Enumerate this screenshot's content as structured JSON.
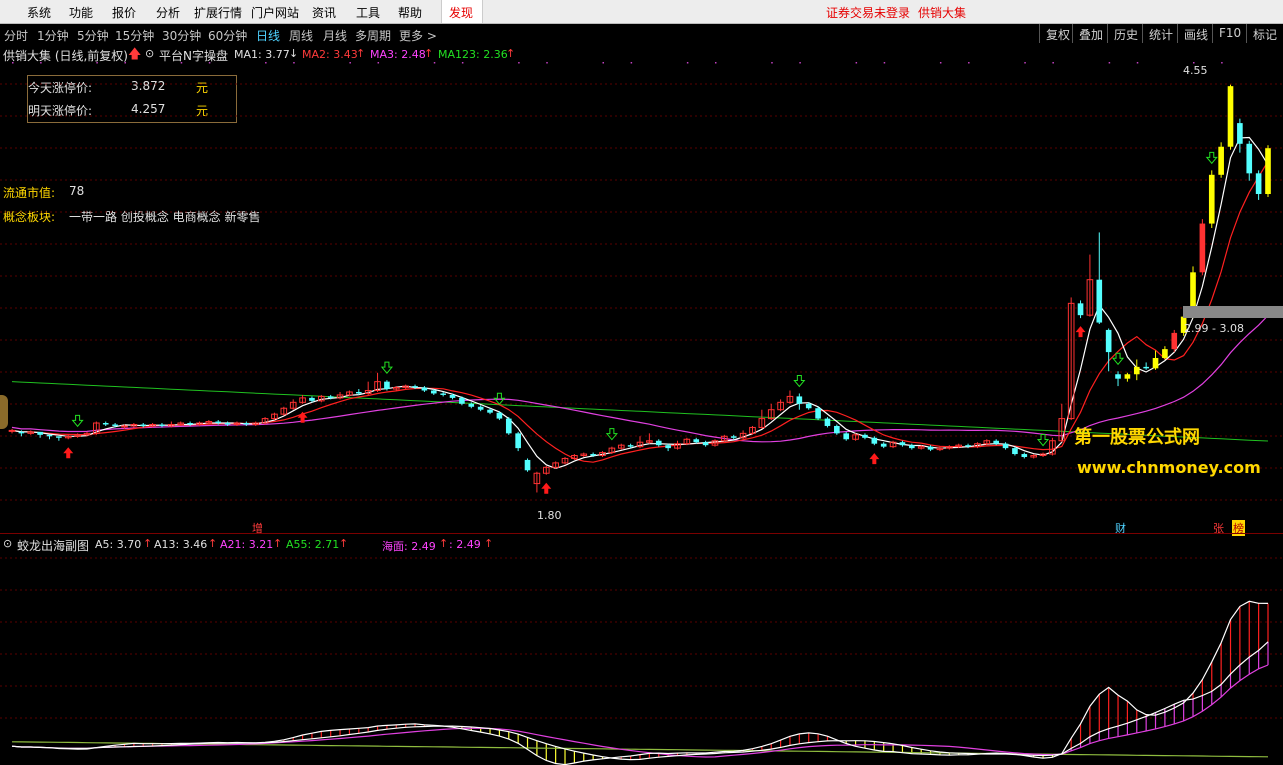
{
  "menu": {
    "items": [
      "系统",
      "功能",
      "报价",
      "分析",
      "扩展行情",
      "门户网站",
      "资讯",
      "工具",
      "帮助"
    ],
    "discover": "发现",
    "login_status": "证券交易未登录",
    "brand": "供销大集"
  },
  "periods": [
    "分时",
    "1分钟",
    "5分钟",
    "15分钟",
    "30分钟",
    "60分钟",
    "日线",
    "周线",
    "月线",
    "多周期",
    "更多 >"
  ],
  "active_period": "日线",
  "right_buttons": [
    "复权",
    "叠加",
    "历史",
    "统计",
    "画线",
    "F10",
    "标记"
  ],
  "main_legend": {
    "title": "供销大集 (日线,前复权)",
    "indicator": "平台N字操盘",
    "ma1": "MA1: 3.77",
    "ma2": "MA2: 3.43",
    "ma3": "MA3: 2.48",
    "ma123": "MA123: 2.36"
  },
  "limit_box": {
    "today_label": "今天涨停价:",
    "today_value": "3.872",
    "tomorrow_label": "明天涨停价:",
    "tomorrow_value": "4.257",
    "unit": "元"
  },
  "float_cap": {
    "label": "流通市值:",
    "value": "78"
  },
  "concept": {
    "label": "概念板块:",
    "value": "一带一路 创投概念 电商概念 新零售"
  },
  "chart_annotations": {
    "high_label": "4.55",
    "low_label": "1.80",
    "range_label": "2.99 - 3.08",
    "watermark_cn": "第一股票公式网",
    "watermark_url": "www.chnmoney.com",
    "marker_zeng": "增",
    "marker_cai": "财",
    "marker_zhang": "张",
    "marker_bang": "榜"
  },
  "sub_legend": {
    "title": "蛟龙出海副图",
    "a5": "A5: 3.70",
    "a13": "A13: 3.46",
    "a21": "A21: 3.21",
    "a55": "A55: 2.71",
    "haimian": "海面: 2.49",
    "haimian2": ": 2.49"
  },
  "colors": {
    "up_candle": "#ff3232",
    "down_candle": "#54ffff",
    "yellow_candle": "#ffff00",
    "ma_white": "#ffffff",
    "ma_red": "#ff2020",
    "ma_magenta": "#e040e0",
    "ma_green": "#20c020"
  },
  "chart_data": {
    "type": "candlestick",
    "series": [
      {
        "name": "MA1",
        "values": [
          3.77
        ]
      },
      {
        "name": "MA2",
        "values": [
          3.43
        ]
      },
      {
        "name": "MA3",
        "values": [
          2.48
        ]
      },
      {
        "name": "MA123",
        "values": [
          2.36
        ]
      }
    ],
    "ylim": [
      1.6,
      4.7
    ],
    "candles": [
      [
        2.22,
        2.22,
        2.2,
        2.23
      ],
      [
        2.21,
        2.2,
        2.18,
        2.22
      ],
      [
        2.2,
        2.21,
        2.19,
        2.22
      ],
      [
        2.21,
        2.19,
        2.17,
        2.21
      ],
      [
        2.19,
        2.18,
        2.16,
        2.19
      ],
      [
        2.18,
        2.17,
        2.15,
        2.18
      ],
      [
        2.17,
        2.18,
        2.16,
        2.19
      ],
      [
        2.18,
        2.19,
        2.17,
        2.2
      ],
      [
        2.19,
        2.2,
        2.18,
        2.21
      ],
      [
        2.2,
        2.27,
        2.19,
        2.28
      ],
      [
        2.27,
        2.26,
        2.25,
        2.28
      ],
      [
        2.26,
        2.25,
        2.24,
        2.27
      ],
      [
        2.25,
        2.25,
        2.23,
        2.26
      ],
      [
        2.25,
        2.26,
        2.24,
        2.27
      ],
      [
        2.26,
        2.25,
        2.24,
        2.27
      ],
      [
        2.25,
        2.26,
        2.24,
        2.27
      ],
      [
        2.26,
        2.25,
        2.24,
        2.27
      ],
      [
        2.25,
        2.26,
        2.24,
        2.28
      ],
      [
        2.26,
        2.27,
        2.25,
        2.28
      ],
      [
        2.27,
        2.26,
        2.25,
        2.28
      ],
      [
        2.26,
        2.27,
        2.25,
        2.28
      ],
      [
        2.27,
        2.28,
        2.26,
        2.29
      ],
      [
        2.28,
        2.27,
        2.26,
        2.29
      ],
      [
        2.27,
        2.26,
        2.25,
        2.28
      ],
      [
        2.26,
        2.27,
        2.25,
        2.28
      ],
      [
        2.27,
        2.26,
        2.25,
        2.28
      ],
      [
        2.26,
        2.27,
        2.25,
        2.28
      ],
      [
        2.27,
        2.3,
        2.26,
        2.31
      ],
      [
        2.3,
        2.33,
        2.29,
        2.34
      ],
      [
        2.33,
        2.37,
        2.32,
        2.38
      ],
      [
        2.37,
        2.41,
        2.36,
        2.43
      ],
      [
        2.41,
        2.44,
        2.4,
        2.46
      ],
      [
        2.44,
        2.42,
        2.41,
        2.45
      ],
      [
        2.42,
        2.45,
        2.41,
        2.46
      ],
      [
        2.45,
        2.44,
        2.43,
        2.46
      ],
      [
        2.44,
        2.46,
        2.43,
        2.48
      ],
      [
        2.46,
        2.48,
        2.45,
        2.49
      ],
      [
        2.48,
        2.47,
        2.46,
        2.5
      ],
      [
        2.47,
        2.49,
        2.46,
        2.55
      ],
      [
        2.49,
        2.55,
        2.48,
        2.61
      ],
      [
        2.55,
        2.5,
        2.49,
        2.56
      ],
      [
        2.5,
        2.51,
        2.49,
        2.52
      ],
      [
        2.51,
        2.52,
        2.5,
        2.53
      ],
      [
        2.52,
        2.51,
        2.5,
        2.53
      ],
      [
        2.51,
        2.49,
        2.48,
        2.52
      ],
      [
        2.49,
        2.47,
        2.46,
        2.5
      ],
      [
        2.47,
        2.46,
        2.45,
        2.48
      ],
      [
        2.46,
        2.44,
        2.43,
        2.47
      ],
      [
        2.44,
        2.4,
        2.39,
        2.45
      ],
      [
        2.4,
        2.38,
        2.37,
        2.41
      ],
      [
        2.38,
        2.36,
        2.35,
        2.39
      ],
      [
        2.36,
        2.34,
        2.33,
        2.37
      ],
      [
        2.34,
        2.3,
        2.29,
        2.35
      ],
      [
        2.3,
        2.2,
        2.19,
        2.31
      ],
      [
        2.2,
        2.1,
        2.08,
        2.21
      ],
      [
        2.02,
        1.95,
        1.94,
        2.03
      ],
      [
        1.86,
        1.93,
        1.8,
        1.94
      ],
      [
        1.93,
        1.97,
        1.92,
        1.98
      ],
      [
        1.97,
        2.0,
        1.96,
        2.01
      ],
      [
        2.0,
        2.03,
        1.99,
        2.04
      ],
      [
        2.03,
        2.05,
        2.02,
        2.06
      ],
      [
        2.05,
        2.06,
        2.04,
        2.07
      ],
      [
        2.06,
        2.05,
        2.04,
        2.07
      ],
      [
        2.05,
        2.07,
        2.04,
        2.08
      ],
      [
        2.07,
        2.1,
        2.06,
        2.11
      ],
      [
        2.1,
        2.12,
        2.09,
        2.13
      ],
      [
        2.12,
        2.11,
        2.1,
        2.13
      ],
      [
        2.11,
        2.14,
        2.1,
        2.18
      ],
      [
        2.14,
        2.15,
        2.13,
        2.2
      ],
      [
        2.15,
        2.12,
        2.11,
        2.16
      ],
      [
        2.12,
        2.1,
        2.08,
        2.13
      ],
      [
        2.1,
        2.13,
        2.09,
        2.15
      ],
      [
        2.13,
        2.16,
        2.12,
        2.17
      ],
      [
        2.16,
        2.14,
        2.13,
        2.17
      ],
      [
        2.14,
        2.12,
        2.11,
        2.15
      ],
      [
        2.12,
        2.15,
        2.11,
        2.16
      ],
      [
        2.15,
        2.18,
        2.14,
        2.19
      ],
      [
        2.18,
        2.17,
        2.16,
        2.19
      ],
      [
        2.17,
        2.2,
        2.16,
        2.22
      ],
      [
        2.2,
        2.24,
        2.19,
        2.25
      ],
      [
        2.24,
        2.3,
        2.23,
        2.36
      ],
      [
        2.3,
        2.36,
        2.29,
        2.4
      ],
      [
        2.36,
        2.41,
        2.35,
        2.43
      ],
      [
        2.41,
        2.45,
        2.4,
        2.49
      ],
      [
        2.45,
        2.4,
        2.36,
        2.47
      ],
      [
        2.4,
        2.37,
        2.36,
        2.41
      ],
      [
        2.37,
        2.3,
        2.29,
        2.38
      ],
      [
        2.3,
        2.25,
        2.24,
        2.31
      ],
      [
        2.25,
        2.2,
        2.19,
        2.26
      ],
      [
        2.2,
        2.16,
        2.15,
        2.21
      ],
      [
        2.16,
        2.19,
        2.15,
        2.2
      ],
      [
        2.19,
        2.17,
        2.16,
        2.2
      ],
      [
        2.17,
        2.13,
        2.12,
        2.18
      ],
      [
        2.13,
        2.11,
        2.1,
        2.14
      ],
      [
        2.11,
        2.14,
        2.1,
        2.15
      ],
      [
        2.14,
        2.12,
        2.11,
        2.15
      ],
      [
        2.12,
        2.1,
        2.09,
        2.13
      ],
      [
        2.1,
        2.11,
        2.09,
        2.12
      ],
      [
        2.11,
        2.09,
        2.08,
        2.12
      ],
      [
        2.09,
        2.1,
        2.08,
        2.11
      ],
      [
        2.1,
        2.11,
        2.09,
        2.12
      ],
      [
        2.11,
        2.12,
        2.1,
        2.13
      ],
      [
        2.12,
        2.11,
        2.1,
        2.13
      ],
      [
        2.11,
        2.13,
        2.1,
        2.14
      ],
      [
        2.13,
        2.15,
        2.12,
        2.16
      ],
      [
        2.15,
        2.13,
        2.12,
        2.16
      ],
      [
        2.13,
        2.1,
        2.09,
        2.14
      ],
      [
        2.1,
        2.06,
        2.05,
        2.11
      ],
      [
        2.06,
        2.04,
        2.03,
        2.07
      ],
      [
        2.04,
        2.05,
        2.03,
        2.06
      ],
      [
        2.05,
        2.06,
        2.04,
        2.07
      ],
      [
        2.06,
        2.15,
        2.05,
        2.17
      ],
      [
        2.15,
        2.3,
        2.14,
        2.4
      ],
      [
        2.3,
        3.08,
        2.29,
        3.12
      ],
      [
        3.08,
        3.0,
        2.98,
        3.1
      ],
      [
        3.0,
        3.24,
        2.99,
        3.41
      ],
      [
        3.24,
        2.95,
        2.94,
        3.56
      ],
      [
        2.9,
        2.75,
        2.62,
        2.91
      ],
      [
        2.6,
        2.57,
        2.52,
        2.62
      ],
      [
        2.57,
        2.6,
        2.55,
        2.61
      ],
      [
        2.6,
        2.65,
        2.56,
        2.7
      ],
      [
        2.65,
        2.64,
        2.63,
        2.68
      ],
      [
        2.64,
        2.71,
        2.63,
        2.76
      ],
      [
        2.71,
        2.77,
        2.7,
        2.79
      ],
      [
        2.77,
        2.88,
        2.75,
        2.9
      ],
      [
        2.88,
        2.99,
        2.86,
        3.01
      ],
      [
        3.0,
        3.29,
        2.98,
        3.33
      ],
      [
        3.29,
        3.62,
        3.27,
        3.65
      ],
      [
        3.62,
        3.95,
        3.59,
        3.98
      ],
      [
        3.95,
        4.14,
        3.93,
        4.17
      ],
      [
        4.14,
        4.55,
        4.12,
        4.56
      ],
      [
        4.3,
        4.16,
        4.1,
        4.33
      ],
      [
        4.16,
        3.96,
        3.91,
        4.18
      ],
      [
        3.96,
        3.82,
        3.78,
        3.98
      ],
      [
        3.82,
        4.13,
        3.8,
        4.15
      ]
    ]
  }
}
